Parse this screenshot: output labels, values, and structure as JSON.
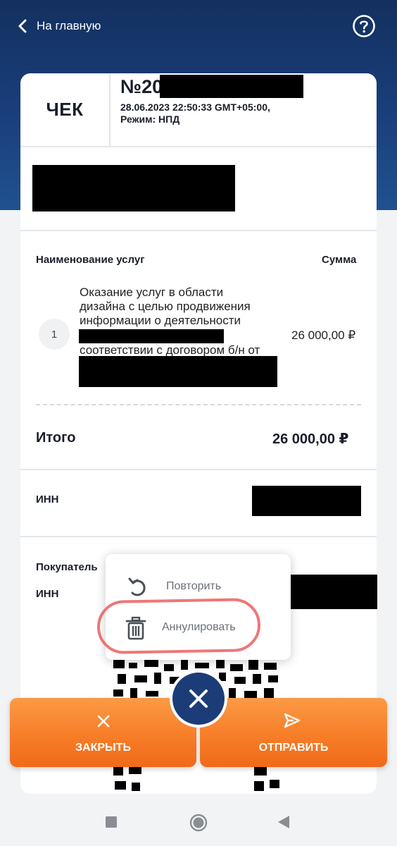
{
  "nav": {
    "back_label": "На главную",
    "help_icon": "help-circle-icon"
  },
  "receipt": {
    "title": "ЧЕК",
    "number_prefix": "№20",
    "datetime": "28.06.2023 22:50:33 GMT+05:00,",
    "mode": "Режим: НПД"
  },
  "services": {
    "header_name": "Наименование услуг",
    "header_sum": "Сумма",
    "items": [
      {
        "index": "1",
        "lines": [
          "Оказание услуг в области",
          "дизайна с целью продвижения",
          "информации о деятельности",
          "",
          "соответствии с договором б/н от"
        ],
        "amount": "26 000,00 ₽"
      }
    ]
  },
  "total": {
    "label": "Итого",
    "value": "26 000,00 ₽"
  },
  "seller": {
    "inn_label": "ИНН"
  },
  "buyer": {
    "label": "Покупатель",
    "inn_label": "ИНН"
  },
  "popup_menu": {
    "items": [
      {
        "label": "Повторить",
        "icon": "undo-icon"
      },
      {
        "label": "Аннулировать",
        "icon": "trash-icon"
      }
    ]
  },
  "actions": {
    "close_label": "ЗАКРЫТЬ",
    "send_label": "ОТПРАВИТЬ",
    "fab_icon": "close-icon"
  },
  "colors": {
    "header_blue": "#1a3f7c",
    "accent_orange": "#f77b26",
    "fab_blue": "#1c3c78",
    "highlight_red": "#eb5f5f"
  }
}
